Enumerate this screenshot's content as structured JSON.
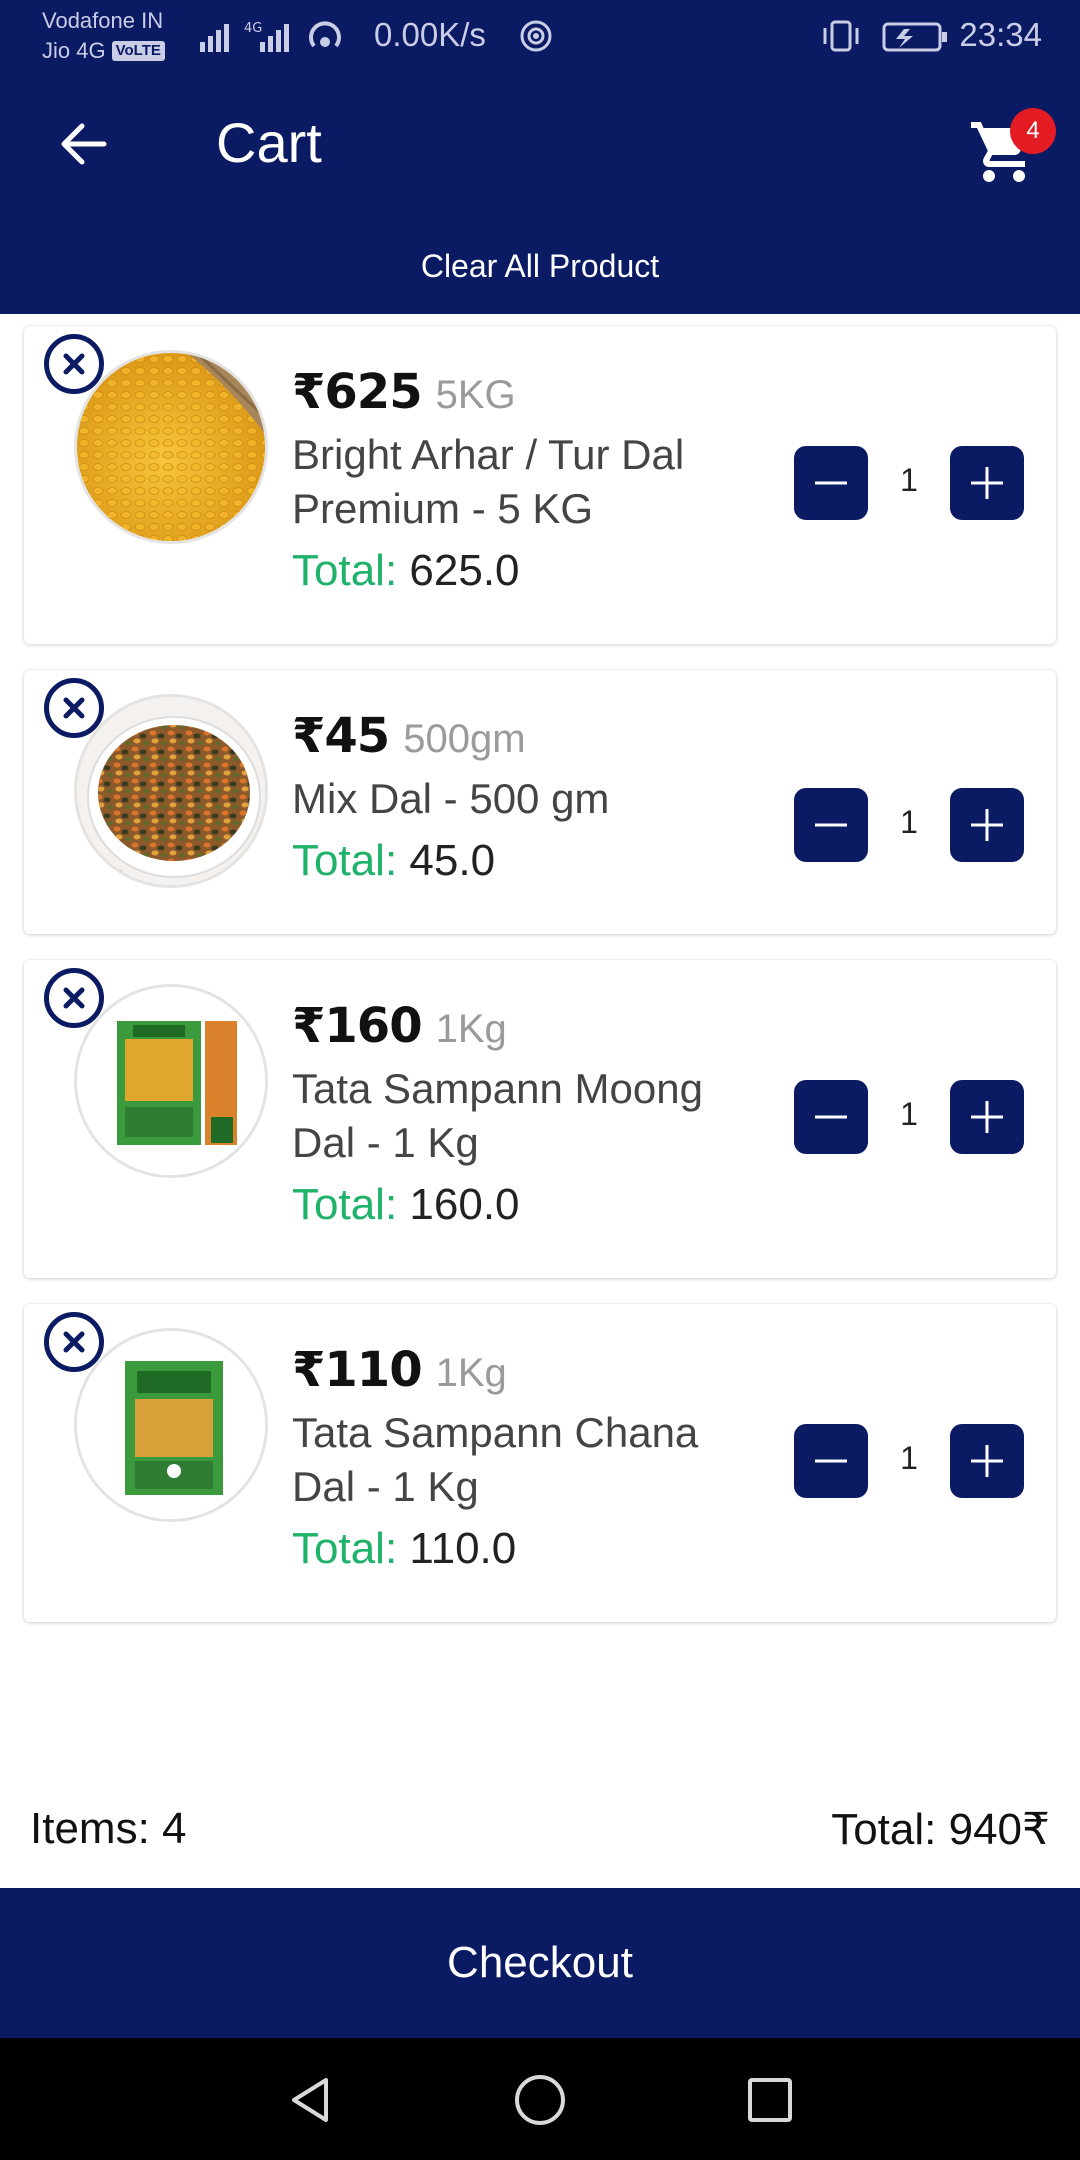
{
  "status_bar": {
    "carrier_line1": "Vodafone IN",
    "carrier_line2": "Jio 4G",
    "volte": "VoLTE",
    "net_speed": "0.00K/s",
    "time": "23:34"
  },
  "header": {
    "title": "Cart",
    "cart_badge": "4",
    "clear_all": "Clear All Product"
  },
  "cart": {
    "items": [
      {
        "price": "₹625",
        "unit": "5KG",
        "name": "Bright Arhar / Tur Dal Premium - 5 KG",
        "total_label": "Total:",
        "total": "625.0",
        "qty": "1"
      },
      {
        "price": "₹45",
        "unit": "500gm",
        "name": "Mix Dal - 500 gm",
        "total_label": "Total:",
        "total": "45.0",
        "qty": "1"
      },
      {
        "price": "₹160",
        "unit": "1Kg",
        "name": "Tata Sampann Moong Dal - 1 Kg",
        "total_label": "Total:",
        "total": "160.0",
        "qty": "1"
      },
      {
        "price": "₹110",
        "unit": "1Kg",
        "name": "Tata Sampann Chana Dal - 1 Kg",
        "total_label": "Total:",
        "total": "110.0",
        "qty": "1"
      }
    ]
  },
  "summary": {
    "items": "Items: 4",
    "total": "Total: 940₹"
  },
  "checkout_label": "Checkout",
  "colors": {
    "primary": "#0a1a63",
    "total_green": "#1fb26b",
    "badge_red": "#e31b23"
  }
}
